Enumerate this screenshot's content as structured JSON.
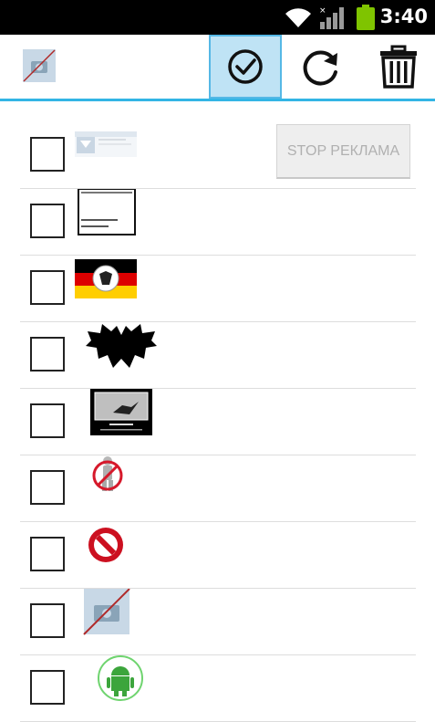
{
  "status_bar": {
    "time": "3:40",
    "icons": [
      "wifi-icon",
      "signal-icon",
      "battery-icon"
    ],
    "battery_color": "#7fc400"
  },
  "action_bar": {
    "app_icon": "no-image-icon",
    "actions": [
      {
        "name": "select-all",
        "icon": "check-circle-icon",
        "selected": true
      },
      {
        "name": "refresh",
        "icon": "refresh-icon",
        "selected": false
      },
      {
        "name": "delete",
        "icon": "trash-icon",
        "selected": false
      }
    ],
    "accent_color": "#33b5e5"
  },
  "stop_ads_button": {
    "label": "STOP РЕКЛАМА"
  },
  "items": [
    {
      "thumbnail": "blurred-screenshot-thumb",
      "checked": false
    },
    {
      "thumbnail": "text-screenshot-thumb",
      "checked": false
    },
    {
      "thumbnail": "german-flag-thumb",
      "checked": false
    },
    {
      "thumbnail": "ink-blot-thumb",
      "checked": false
    },
    {
      "thumbnail": "motivator-poster-thumb",
      "checked": false
    },
    {
      "thumbnail": "no-sign-figure-thumb",
      "checked": false
    },
    {
      "thumbnail": "prohibition-sign-thumb",
      "checked": false
    },
    {
      "thumbnail": "no-image-thumb",
      "checked": false
    },
    {
      "thumbnail": "android-logo-thumb",
      "checked": false
    }
  ]
}
